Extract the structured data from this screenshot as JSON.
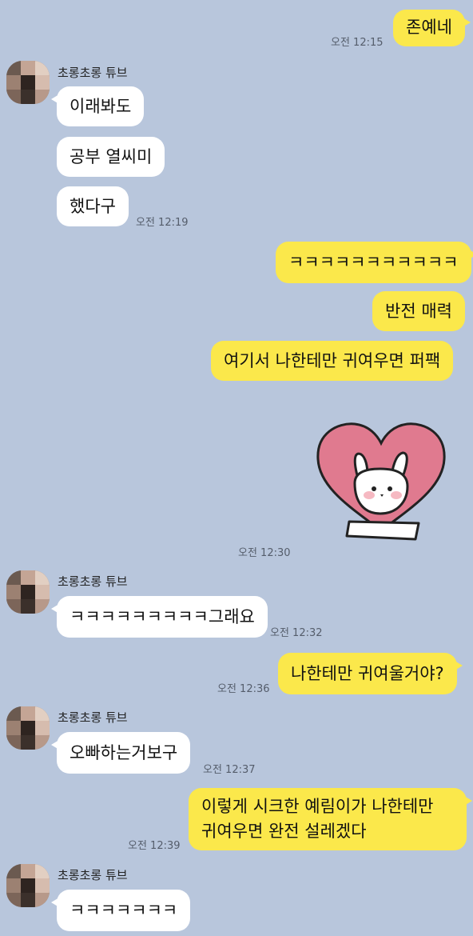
{
  "contact": {
    "name": "초롱초롱 튜브"
  },
  "messages": {
    "m1": {
      "text": "존예네",
      "time": "오전 12:15"
    },
    "m2": {
      "text": "이래봐도"
    },
    "m3": {
      "text": "공부 열씨미"
    },
    "m4": {
      "text": "했다구",
      "time": "오전 12:19"
    },
    "m5": {
      "text": "ㅋㅋㅋㅋㅋㅋㅋㅋㅋㅋㅋ"
    },
    "m6": {
      "text": "반전 매력"
    },
    "m7": {
      "text": "여기서 나한테만 귀여우면 퍼팩"
    },
    "m8": {
      "sticker": "bunny-heart-sticker",
      "time": "오전 12:30"
    },
    "m9": {
      "text": "ㅋㅋㅋㅋㅋㅋㅋㅋㅋ그래요",
      "time": "오전 12:32"
    },
    "m10": {
      "text": "나한테만 귀여울거야?",
      "time": "오전 12:36"
    },
    "m11": {
      "text": "오빠하는거보구",
      "time": "오전 12:37"
    },
    "m12": {
      "line1": "이렇게 시크한 예림이가 나한테만",
      "line2": "귀여우면 완전 설레겠다",
      "time": "오전 12:39"
    },
    "m13": {
      "text": "ㅋㅋㅋㅋㅋㅋㅋ"
    }
  },
  "colors": {
    "background": "#b8c6dc",
    "my_bubble": "#fbe84b",
    "their_bubble": "#ffffff"
  }
}
